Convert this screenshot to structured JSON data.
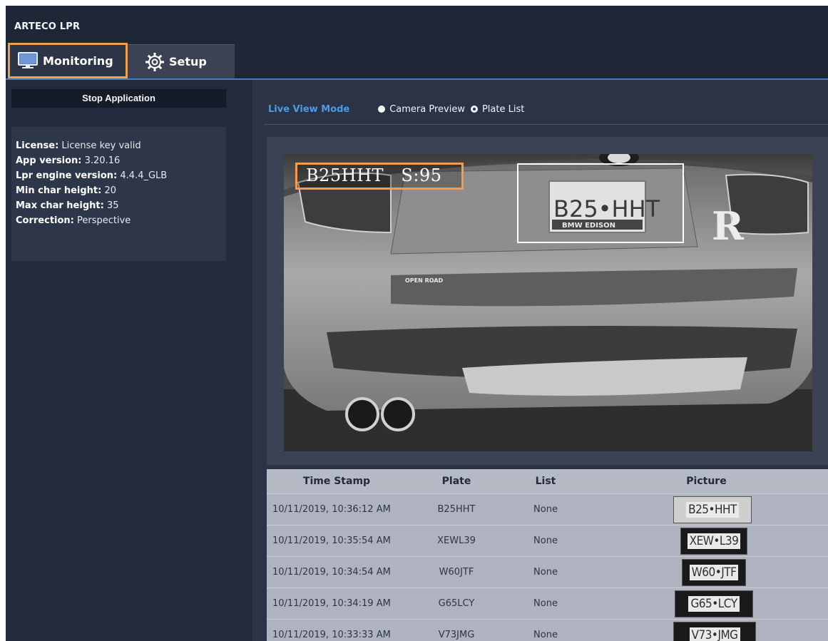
{
  "app": {
    "title": "ARTECO LPR"
  },
  "tabs": [
    {
      "label": "Monitoring",
      "icon": "monitor-icon",
      "active": true,
      "highlight_color": "#f39c4b"
    },
    {
      "label": "Setup",
      "icon": "gear-icon",
      "active": false
    }
  ],
  "sidebar": {
    "stop_button": "Stop Application",
    "info": [
      {
        "label": "License:",
        "value": "License key valid"
      },
      {
        "label": "App version:",
        "value": "3.20.16"
      },
      {
        "label": "Lpr engine version:",
        "value": "4.4.4_GLB"
      },
      {
        "label": "Min char height:",
        "value": "20"
      },
      {
        "label": "Max char height:",
        "value": "35"
      },
      {
        "label": "Correction:",
        "value": "Perspective"
      }
    ]
  },
  "live_view": {
    "mode_title": "Live View Mode",
    "options": [
      {
        "label": "Camera Preview",
        "selected": false
      },
      {
        "label": "Plate List",
        "selected": true
      }
    ],
    "overlay_text": "B25HHT   S:95",
    "camera_plate_text": "B25•HHT",
    "camera_plate_bottom_text": "BMW EDISON",
    "camera_badge_text": "OPEN ROAD",
    "camera_letter": "R"
  },
  "table": {
    "headers": [
      "Time Stamp",
      "Plate",
      "List",
      "Picture"
    ],
    "rows": [
      {
        "time": "10/11/2019, 10:36:12 AM",
        "plate": "B25HHT",
        "list": "None",
        "picture_text": "B25•HHT"
      },
      {
        "time": "10/11/2019, 10:35:54 AM",
        "plate": "XEWL39",
        "list": "None",
        "picture_text": "XEW•L39"
      },
      {
        "time": "10/11/2019, 10:34:54 AM",
        "plate": "W60JTF",
        "list": "None",
        "picture_text": "W60•JTF"
      },
      {
        "time": "10/11/2019, 10:34:19 AM",
        "plate": "G65LCY",
        "list": "None",
        "picture_text": "G65•LCY"
      },
      {
        "time": "10/11/2019, 10:33:33 AM",
        "plate": "V73JMG",
        "list": "None",
        "picture_text": "V73•JMG"
      }
    ]
  },
  "colors": {
    "accent": "#4c9be8",
    "highlight": "#f39c4b",
    "header_bg": "#1f2636"
  }
}
